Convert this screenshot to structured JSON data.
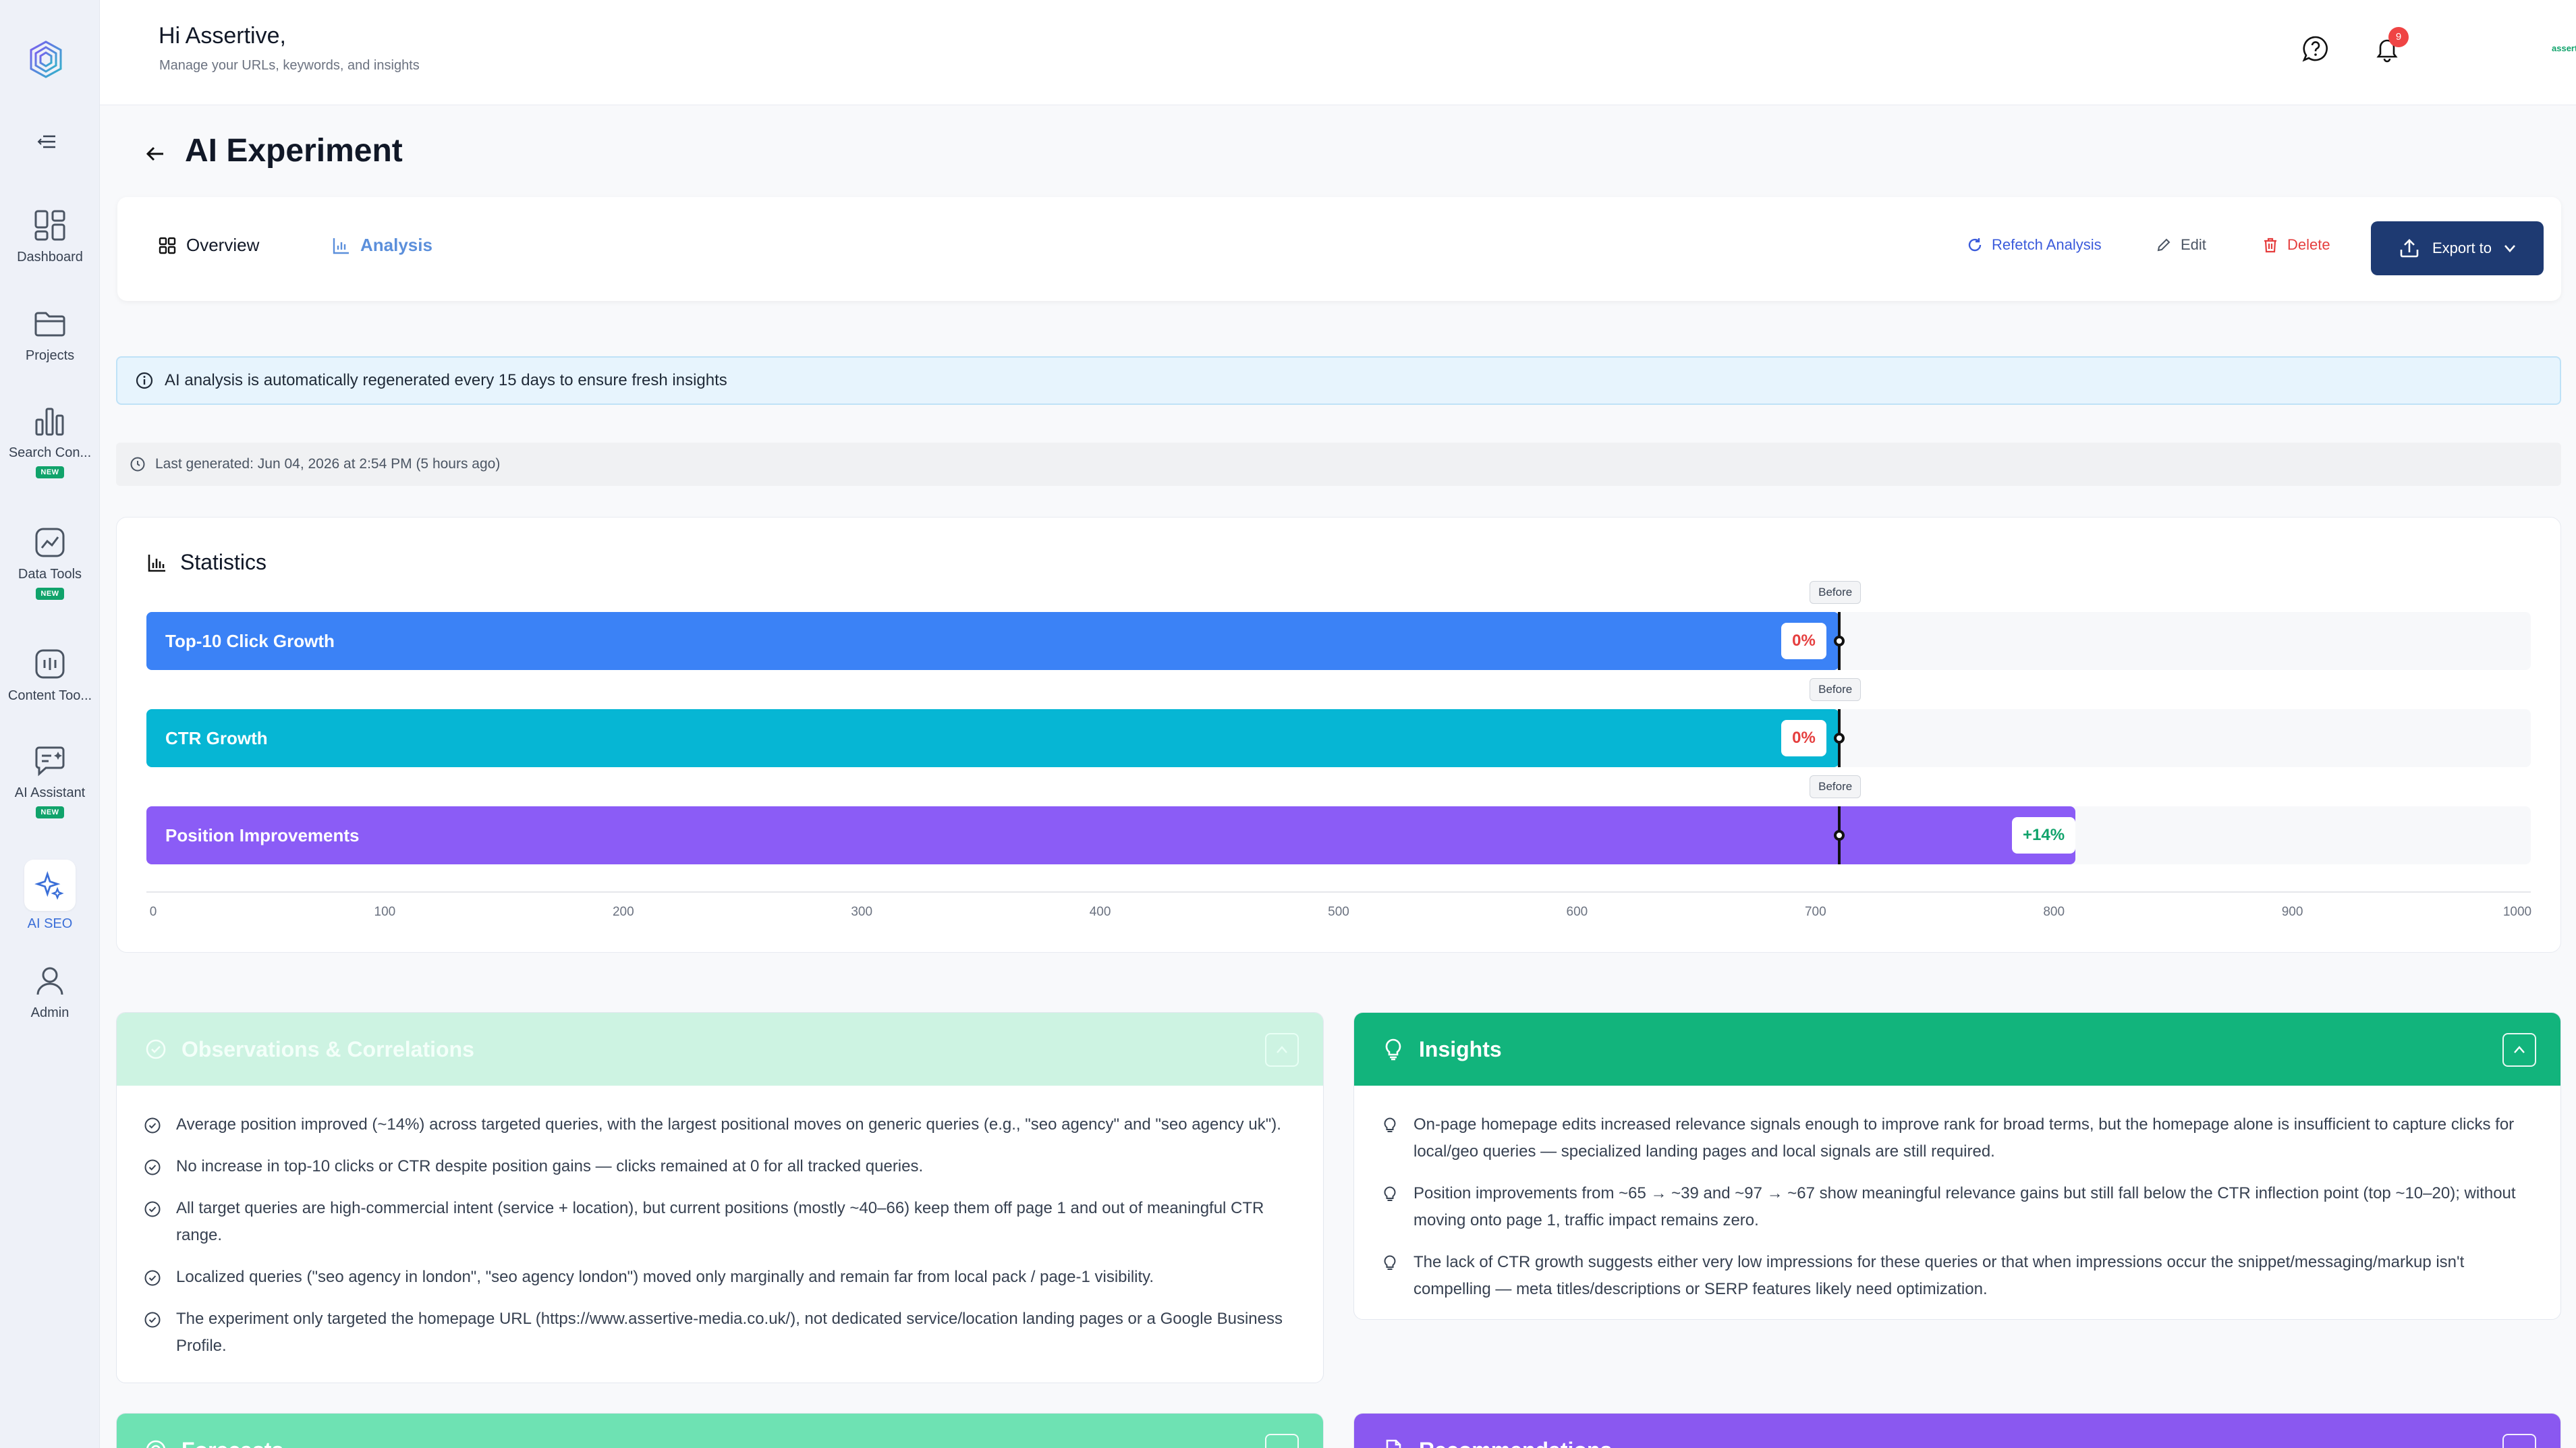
{
  "header": {
    "greeting": "Hi Assertive,",
    "subtitle": "Manage your URLs, keywords, and insights",
    "notifications_count": "9",
    "user_name": "assertive"
  },
  "sidebar": {
    "items": [
      {
        "label": "Dashboard",
        "icon": "dashboard-icon",
        "badge": ""
      },
      {
        "label": "Projects",
        "icon": "folder-icon",
        "badge": ""
      },
      {
        "label": "Search Con...",
        "icon": "bar-chart-icon",
        "badge": "NEW"
      },
      {
        "label": "Data Tools",
        "icon": "trend-icon",
        "badge": "NEW"
      },
      {
        "label": "Content Too...",
        "icon": "content-icon",
        "badge": ""
      },
      {
        "label": "AI Assistant",
        "icon": "chat-sparkle-icon",
        "badge": "NEW"
      },
      {
        "label": "AI SEO",
        "icon": "sparkle-icon",
        "badge": "",
        "active": true
      },
      {
        "label": "Admin",
        "icon": "user-icon",
        "badge": ""
      }
    ]
  },
  "page": {
    "title": "AI Experiment",
    "tabs": [
      {
        "label": "Overview",
        "icon": "grid-icon",
        "active": false
      },
      {
        "label": "Analysis",
        "icon": "chart-icon",
        "active": true
      }
    ],
    "actions": {
      "refetch": "Refetch Analysis",
      "edit": "Edit",
      "delete": "Delete",
      "export": "Export to"
    },
    "info_banner": "AI analysis is automatically regenerated every 15 days to ensure fresh insights",
    "last_generated": "Last generated: Jun 04, 2026 at 2:54 PM (5 hours ago)"
  },
  "statistics": {
    "title": "Statistics",
    "marker_label": "Before",
    "axis_max": 1000,
    "marker_value": 710,
    "ticks": [
      "0",
      "100",
      "200",
      "300",
      "400",
      "500",
      "600",
      "700",
      "800",
      "900",
      "1000"
    ],
    "bars": [
      {
        "label": "Top-10 Click Growth",
        "value": 710,
        "badge": "0%",
        "color": "#3b82f6",
        "badge_type": "zero"
      },
      {
        "label": "CTR Growth",
        "value": 710,
        "badge": "0%",
        "color": "#06b6d4",
        "badge_type": "zero"
      },
      {
        "label": "Position Improvements",
        "value": 809,
        "badge": "+14%",
        "color": "#8b5cf6",
        "badge_type": "pos"
      }
    ]
  },
  "observations": {
    "title": "Observations & Correlations",
    "items": [
      "Average position improved (~14%) across targeted queries, with the largest positional moves on generic queries (e.g., \"seo agency\" and \"seo agency uk\").",
      "No increase in top-10 clicks or CTR despite position gains — clicks remained at 0 for all tracked queries.",
      "All target queries are high-commercial intent (service + location), but current positions (mostly ~40–66) keep them off page 1 and out of meaningful CTR range.",
      "Localized queries (\"seo agency in london\", \"seo agency london\") moved only marginally and remain far from local pack / page-1 visibility.",
      "The experiment only targeted the homepage URL (https://www.assertive-media.co.uk/), not dedicated service/location landing pages or a Google Business Profile."
    ]
  },
  "insights": {
    "title": "Insights",
    "items": [
      "On-page homepage edits increased relevance signals enough to improve rank for broad terms, but the homepage alone is insufficient to capture clicks for local/geo queries — specialized landing pages and local signals are still required.",
      "Position improvements from ~65 → ~39 and ~97 → ~67 show meaningful relevance gains but still fall below the CTR inflection point (top ~10–20); without moving onto page 1, traffic impact remains zero.",
      "The lack of CTR growth suggests either very low impressions for these queries or that when impressions occur the snippet/messaging/markup isn't compelling — meta titles/descriptions or SERP features likely need optimization."
    ]
  },
  "momentum": {
    "title": "Forecasts"
  },
  "recommendations": {
    "title": "Recommendations"
  },
  "colors": {
    "navy": "#1e3a72",
    "green": "#12b47c",
    "purple": "#8a58f0",
    "red": "#e53e3e"
  }
}
